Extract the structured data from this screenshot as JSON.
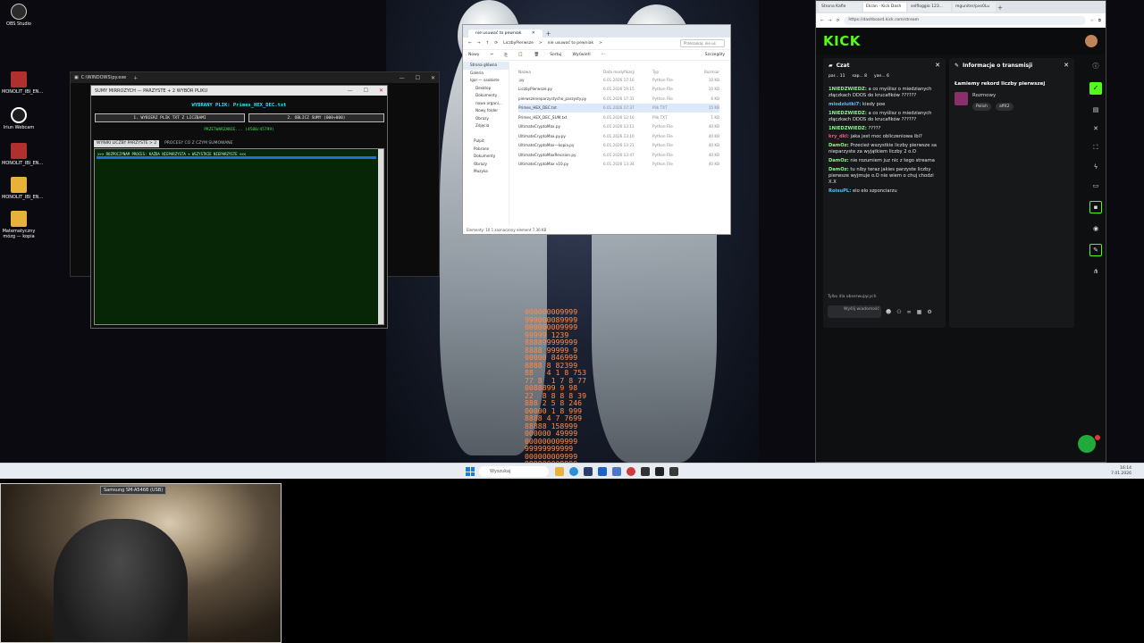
{
  "desktop": {
    "icons": [
      {
        "label": "OBS Studio",
        "color": "#2b2b2b"
      },
      {
        "label": "MONOLIT_IBI_EN...",
        "color": "#b03030"
      },
      {
        "label": "Iriun Webcam",
        "color": "#1d1d1d"
      },
      {
        "label": "MONOLIT_IBI_EN...",
        "color": "#b03030"
      },
      {
        "label": "MONOLIT_IBI_EN...",
        "color": "#e8b13a"
      },
      {
        "label": "Matematyczny mózg — kopia",
        "color": "#e8b13a"
      }
    ],
    "wallpaper_text": "MONOLIT IBI EN",
    "code_art": "000000009999\n999000089999\n000000009999\n99999 1239\n888899999999\n8888 99999 9\n00000 846999\n8888 8 82399\n88   4 1 8 753\n77 8  1 7 8 77\n0088899 9 98\n22  8 8 8 8 39\n888 2 5 8 246\n00000 1 8 999\n8888 4 7 7699\n88888 158999\n000000 49999\n000000009999\n99999999999\n000000009999\n999900009999\n000000009999"
  },
  "console": {
    "title": "C:\\WINDOWS\\py.exe"
  },
  "app": {
    "title": "SUMY MIRROZYCH — PARZYSTE + 2 WYBÓR PLIKU",
    "file_label": "WYBRANY PLIK: Primes_HEX_DEC.txt",
    "btn1": "1. WYBIERZ PLIK TXT Z LICZBAMI",
    "btn2": "2. OBLICZ SUMY (000+000)",
    "status": "PRZETWARZANIE... (4500/45799)",
    "tab1": "WYNIKI LICZBY PARZYSTE > 2",
    "tab2": "PROCESY CO Z CZYM SUMOWANE",
    "log": ">>> ROZPOCZYNAM PROCES: KAŻDA NIEPARZYSTA + WSZYSTKIE NIEPARZYSTE <<<"
  },
  "explorer": {
    "tab": "nie usuwać to pewniak",
    "crumbs": [
      "LiczbyPierwsze",
      ">",
      "nie usuwać to pewniak",
      ">"
    ],
    "search_placeholder": "Przeszukaj: nie us",
    "toolbar": [
      "Nowy",
      "Sortuj",
      "Wyświetl",
      "Szczegóły"
    ],
    "sidebar": [
      "Strona główna",
      "Galeria",
      "Igor — osobiste",
      "Desktop",
      "Dokumenty",
      "nowa organi...",
      "Nowy folder",
      "Obrazy",
      "Zdjęcia",
      "",
      "Pulpit",
      "Pobrane",
      "Dokumenty",
      "Obrazy",
      "Muzyka"
    ],
    "columns": [
      "Nazwa",
      "Data modyfikacji",
      "Typ",
      "Rozmiar"
    ],
    "files": [
      {
        "name": ".py",
        "date": "6.01.2026 17:16",
        "type": "Python File",
        "size": "10 KB"
      },
      {
        "name": "LiczbyPierwsze.py",
        "date": "6.01.2026 19:15",
        "type": "Python File",
        "size": "10 KB"
      },
      {
        "name": "pierwszenieparzystycho_parzysty.py",
        "date": "6.01.2026 17:31",
        "type": "Python File",
        "size": "6 KB"
      },
      {
        "name": "Primes_HEX_DEC.txt",
        "date": "6.01.2026 17:37",
        "type": "Plik TXT",
        "size": "15 KB"
      },
      {
        "name": "Primes_HEX_DEC_SUM.txt",
        "date": "6.01.2026 12:16",
        "type": "Plik TXT",
        "size": "1 KB"
      },
      {
        "name": "UltimateCryptoMax.py",
        "date": "6.01.2026 13:11",
        "type": "Python File",
        "size": "40 KB"
      },
      {
        "name": "UltimateCryptoMax.py.py",
        "date": "6.01.2026 13:10",
        "type": "Python File",
        "size": "40 KB"
      },
      {
        "name": "UltimateCryptoMax—kopia.py",
        "date": "6.01.2026 13:21",
        "type": "Python File",
        "size": "40 KB"
      },
      {
        "name": "UltimateCryptoMaxRevision.py",
        "date": "6.01.2026 13:47",
        "type": "Python File",
        "size": "40 KB"
      },
      {
        "name": "UltimateCryptoMax v10.py",
        "date": "6.01.2026 13:34",
        "type": "Python File",
        "size": "40 KB"
      }
    ],
    "status": "Elementy: 10    1 zaznaczony element  7,36 KB"
  },
  "browser": {
    "tabs": [
      "Strona Kafle",
      "Ekran · Kick Dash",
      "selfloggio 123...",
      "mguniter/pxs0Lu"
    ],
    "url": "https://dashboard.kick.com/stream",
    "logo": "KICK",
    "chat": {
      "title": "Czat",
      "pinned": [
        "par... 11",
        "sap... 8",
        "yan... 6"
      ],
      "messages": [
        {
          "user": "1NIEDZWIEDZ:",
          "color": "#8cf58c",
          "text": " a co myślisz o miedzianych złączkach DDOS do krucafików ??????"
        },
        {
          "user": "miodziutki7:",
          "color": "#4ac3ff",
          "text": " kiedy poe"
        },
        {
          "user": "1NIEDZWIEDZ:",
          "color": "#8cf58c",
          "text": " a co myślisz o miedzianych złączkach DDOS do krucafików ??????"
        },
        {
          "user": "1NIEDZWIEDZ:",
          "color": "#8cf58c",
          "text": " ?????"
        },
        {
          "user": "kry_dkl:",
          "color": "#ff4e7a",
          "text": " jaka jest moc obliczeniowa ibi?"
        },
        {
          "user": "DamOz:",
          "color": "#8cf58c",
          "text": " Przecież wszystkie liczby pierwsze sa nieparzyste za wyjątkiem liczby 2 o.O"
        },
        {
          "user": "DamOz:",
          "color": "#8cf58c",
          "text": " nie rozumiem juz nic z tego streama"
        },
        {
          "user": "DamOz:",
          "color": "#8cf58c",
          "text": " tu niby teraz jakies parzyste liczby pierwsze wyjmuje o.O nie wiem o chuj chodzi X.X"
        },
        {
          "user": "RoisuPL:",
          "color": "#4ac3ff",
          "text": " elo elo szponciarzu"
        }
      ],
      "followers_note": "Tylko dla obserwujących",
      "input_placeholder": "Wyślij wiadomość"
    },
    "info": {
      "title": "Informacje o transmisji",
      "stream_title": "Łamiemy rekord liczby pierwszej",
      "category": "Rozmowy",
      "tags": [
        "Polish",
        "aff42"
      ]
    }
  },
  "taskbar": {
    "search": "Wyszukaj",
    "time": "16:14",
    "date": "7.01.2026"
  },
  "webcam": {
    "label": "Samsung SM-A546B (USB)"
  }
}
